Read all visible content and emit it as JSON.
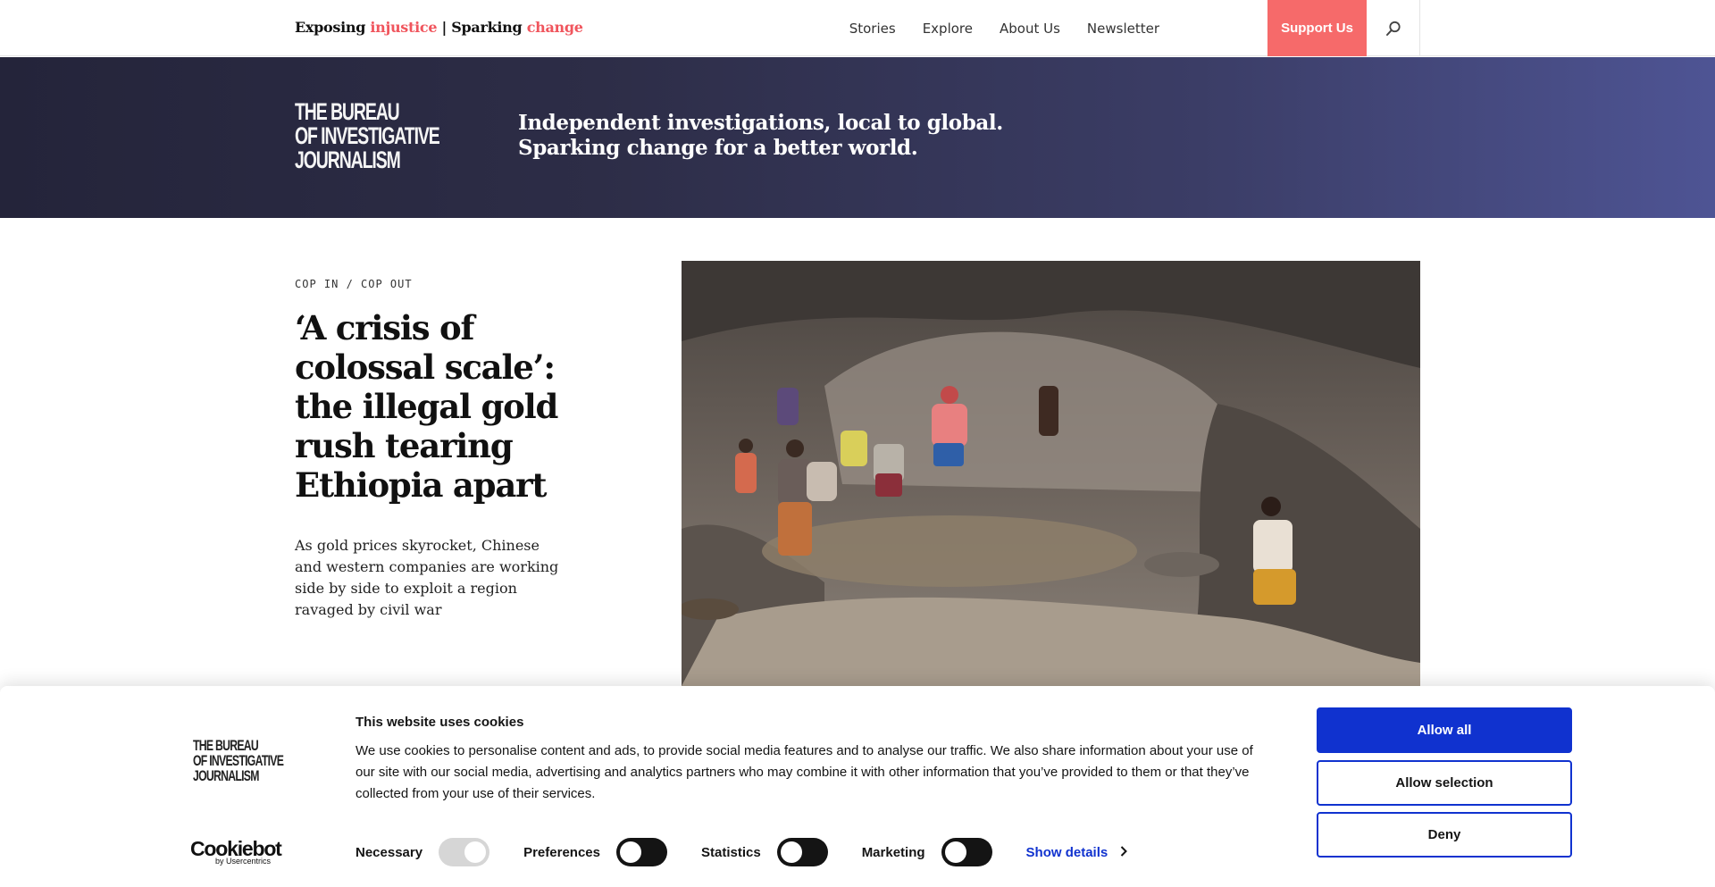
{
  "nav": {
    "tagline": {
      "part1": "Exposing ",
      "accent1": "injustice",
      "part2": " | Sparking ",
      "accent2": "change"
    },
    "links": [
      "Stories",
      "Explore",
      "About Us",
      "Newsletter"
    ],
    "support": "Support Us",
    "search_icon": "search-icon",
    "accent_color": "#f66a6a"
  },
  "hero": {
    "logo_lines": [
      "THE BUREAU",
      "OF INVESTIGATIVE",
      "JOURNALISM"
    ],
    "line1": "Independent investigations, local to global.",
    "line2": "Sparking change for a better world."
  },
  "article": {
    "kicker": "COP IN / COP OUT",
    "headline": "‘A crisis of colossal scale’: the illegal gold rush tearing Ethiopia apart",
    "standfirst": "As gold prices skyrocket, Chinese and western companies are working side by side to exploit a region ravaged by civil war"
  },
  "cookie": {
    "logo_lines": [
      "THE BUREAU",
      "OF INVESTIGATIVE",
      "JOURNALISM"
    ],
    "brand": "Cookiebot",
    "brand_sub": "by Usercentrics",
    "title": "This website uses cookies",
    "body": "We use cookies to personalise content and ads, to provide social media features and to analyse our traffic. We also share information about your use of our site with our social media, advertising and analytics partners who may combine it with other information that you’ve provided to them or that they’ve collected from your use of their services.",
    "toggles": {
      "necessary": "Necessary",
      "preferences": "Preferences",
      "statistics": "Statistics",
      "marketing": "Marketing"
    },
    "show_details": "Show details",
    "allow_all": "Allow all",
    "allow_selection": "Allow selection",
    "deny": "Deny",
    "button_color": "#1032cf"
  }
}
